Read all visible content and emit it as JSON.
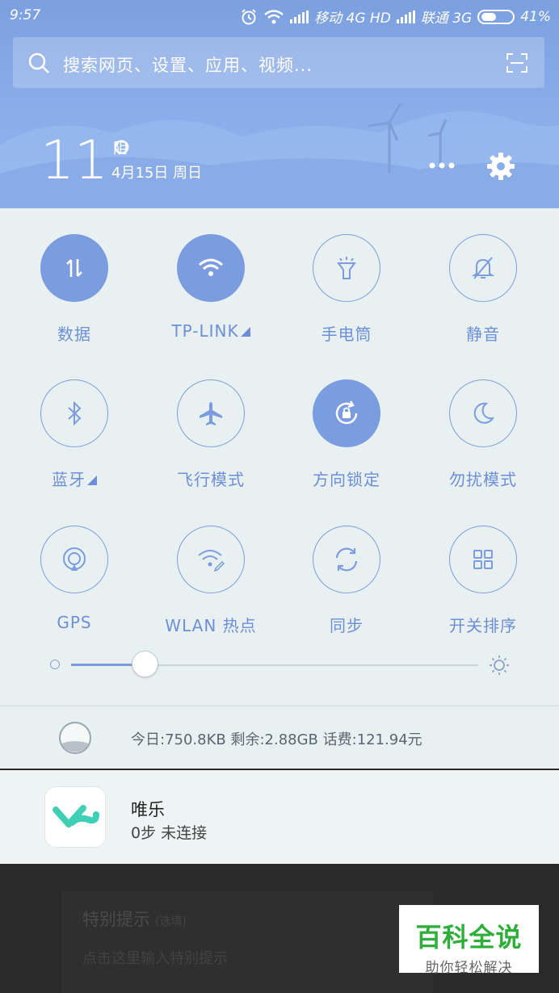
{
  "status_bar": {
    "time": "9:57",
    "carrier1": "移动 4G HD",
    "carrier2": "联通 3G",
    "battery": "41%"
  },
  "search": {
    "placeholder": "搜索网页、设置、应用、视频..."
  },
  "weather": {
    "temperature": "11°",
    "condition": "阴",
    "date": "4月15日 周日"
  },
  "tiles": [
    {
      "label": "数据",
      "icon": "data-icon",
      "on": true
    },
    {
      "label": "TP-LINK",
      "icon": "wifi-icon",
      "on": true
    },
    {
      "label": "手电筒",
      "icon": "flashlight-icon",
      "on": false
    },
    {
      "label": "静音",
      "icon": "mute-bell-icon",
      "on": false
    },
    {
      "label": "蓝牙",
      "icon": "bluetooth-icon",
      "on": false
    },
    {
      "label": "飞行模式",
      "icon": "airplane-icon",
      "on": false
    },
    {
      "label": "方向锁定",
      "icon": "rotation-lock-icon",
      "on": true
    },
    {
      "label": "勿扰模式",
      "icon": "moon-icon",
      "on": false
    },
    {
      "label": "GPS",
      "icon": "gps-icon",
      "on": false
    },
    {
      "label": "WLAN 热点",
      "icon": "hotspot-icon",
      "on": false
    },
    {
      "label": "同步",
      "icon": "sync-icon",
      "on": false
    },
    {
      "label": "开关排序",
      "icon": "grid-icon",
      "on": false
    }
  ],
  "brightness": {
    "level": 0.18
  },
  "data_usage": {
    "text": "今日:750.8KB   剩余:2.88GB   话费:121.94元"
  },
  "notification": {
    "app": "唯乐",
    "text": "0步  未连接"
  },
  "background_card": {
    "title": "特别提示",
    "title_hint": "(选填)",
    "placeholder": "点击这里输入特别提示"
  },
  "watermark": {
    "title": "百科全说",
    "subtitle": "助你轻松解决"
  },
  "colors": {
    "accent": "#7b9de0",
    "panel": "#e9f0f1",
    "header": "#8aaeea"
  }
}
